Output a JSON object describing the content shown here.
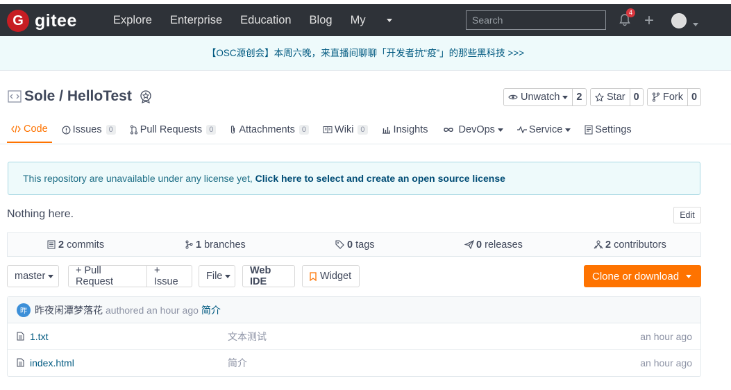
{
  "header": {
    "brand": "gitee",
    "logo_letter": "G",
    "nav": [
      "Explore",
      "Enterprise",
      "Education",
      "Blog",
      "My"
    ],
    "search_placeholder": "Search",
    "notification_count": "4"
  },
  "banner": {
    "text": "【OSC源创会】本周六晚，来直播间聊聊「开发者抗“疫”」的那些黑科技 >>>"
  },
  "repo": {
    "owner_and_name": "Sole / HelloTest",
    "watch": {
      "label": "Unwatch",
      "count": "2"
    },
    "star": {
      "label": "Star",
      "count": "0"
    },
    "fork": {
      "label": "Fork",
      "count": "0"
    }
  },
  "tabs": [
    {
      "label": "Code"
    },
    {
      "label": "Issues",
      "count": "0"
    },
    {
      "label": "Pull Requests",
      "count": "0"
    },
    {
      "label": "Attachments",
      "count": "0"
    },
    {
      "label": "Wiki",
      "count": "0"
    },
    {
      "label": "Insights"
    },
    {
      "label": "DevOps"
    },
    {
      "label": "Service"
    },
    {
      "label": "Settings"
    }
  ],
  "license_notice": {
    "text": "This repository are unavailable under any license yet, ",
    "link": "Click here to select and create an open source license"
  },
  "description": "Nothing here.",
  "edit_label": "Edit",
  "stats": {
    "commits": {
      "count": "2",
      "label": "commits"
    },
    "branches": {
      "count": "1",
      "label": "branches"
    },
    "tags": {
      "count": "0",
      "label": "tags"
    },
    "releases": {
      "count": "0",
      "label": "releases"
    },
    "contributors": {
      "count": "2",
      "label": "contributors"
    }
  },
  "controls": {
    "branch": "master",
    "pull_request": "+ Pull Request",
    "issue": "+ Issue",
    "file": "File",
    "web_ide": "Web IDE",
    "widget": "Widget",
    "clone": "Clone or download"
  },
  "last_commit": {
    "avatar_char": "昨",
    "author": "昨夜闲潭梦落花",
    "authored": "authored an hour ago",
    "message": "简介"
  },
  "files": [
    {
      "name": "1.txt",
      "message": "文本测试",
      "time": "an hour ago"
    },
    {
      "name": "index.html",
      "message": "简介",
      "time": "an hour ago"
    }
  ],
  "colors": {
    "accent": "#fe7300",
    "header_bg": "#2e3238",
    "logo_red": "#c71d23",
    "link": "#005980"
  }
}
